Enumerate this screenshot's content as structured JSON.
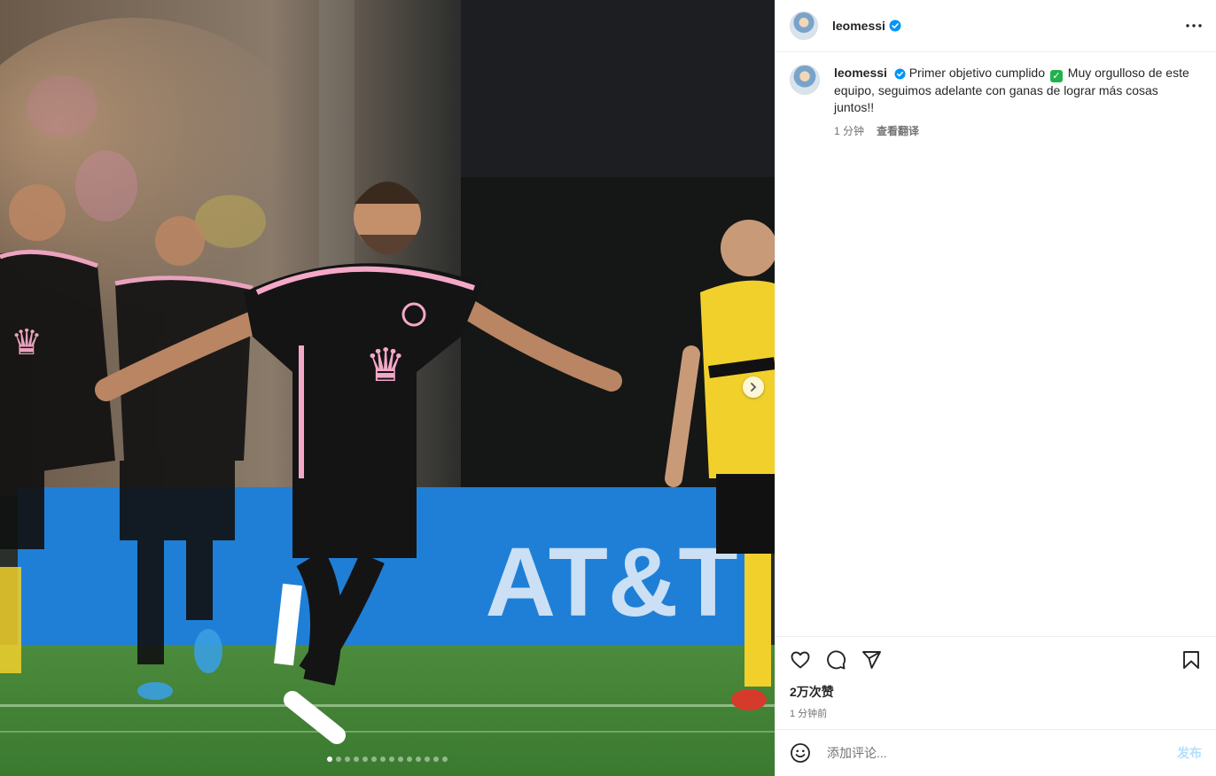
{
  "post": {
    "username": "leomessi",
    "more_icon": "more-horizontal-icon",
    "verified_icon": "verified-badge-icon"
  },
  "caption": {
    "username": "leomessi",
    "text_before_emoji": "Primer objetivo cumplido",
    "emoji": "✓",
    "text_after_emoji": "Muy orgulloso de este equipo, seguimos adelante con ganas de lograr más cosas juntos!!",
    "time": "1 分钟",
    "translate_label": "查看翻译"
  },
  "actions": {
    "like_icon": "heart-icon",
    "comment_icon": "comment-icon",
    "share_icon": "share-icon",
    "save_icon": "bookmark-icon",
    "likes_text": "2万次赞",
    "posted_ago": "1 分钟前"
  },
  "comment": {
    "emoji_icon": "smiley-icon",
    "placeholder": "添加评论...",
    "post_label": "发布"
  },
  "carousel": {
    "slide_count": 14,
    "active_index": 0,
    "next_icon": "chevron-right-icon",
    "ad_board_text": "AT&T"
  },
  "colors": {
    "verified": "#0095f6",
    "post_button_disabled": "#b2dffc",
    "jersey_pink": "#f4a8c8",
    "opponent_yellow": "#f2d02c"
  }
}
